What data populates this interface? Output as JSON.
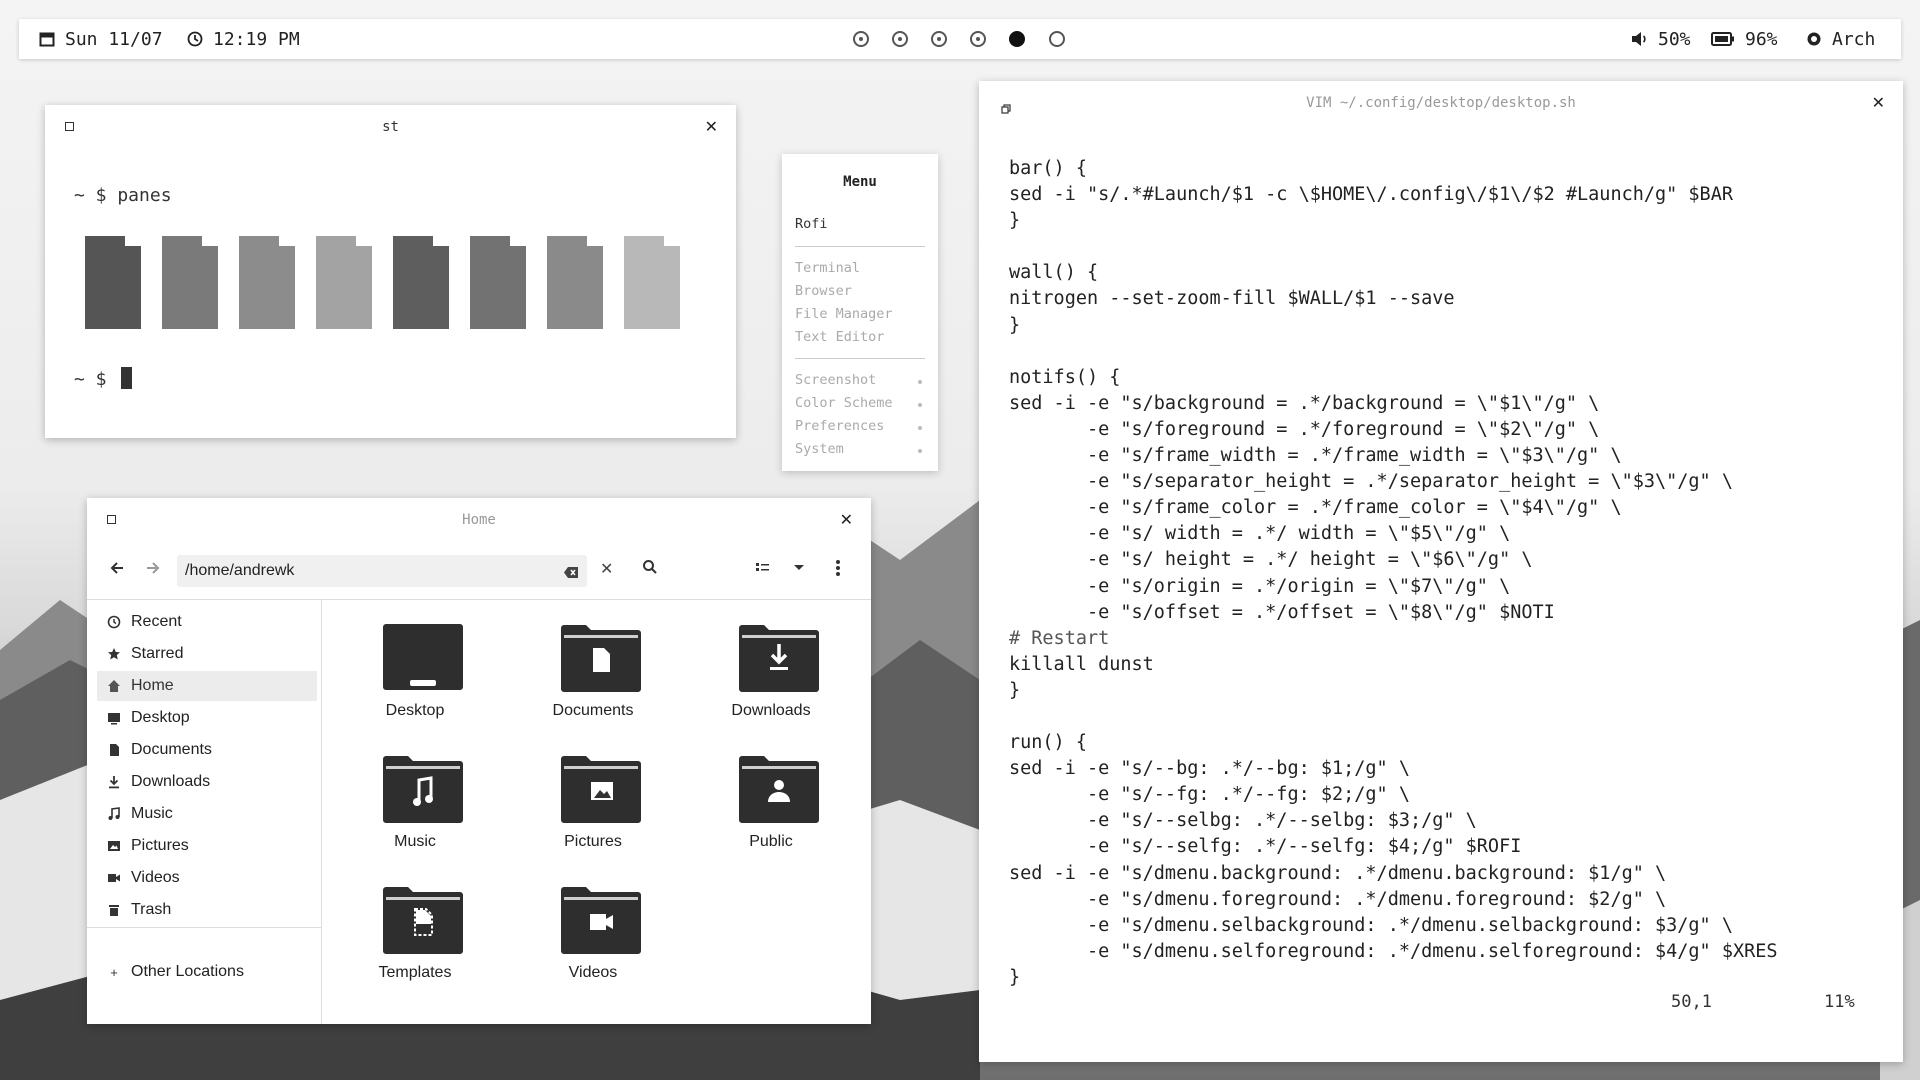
{
  "topbar": {
    "date": "Sun 11/07",
    "time": "12:19 PM",
    "volume": "50%",
    "battery": "96%",
    "os": "Arch",
    "workspaces": [
      "dot",
      "dot",
      "dot",
      "dot",
      "active",
      "empty"
    ]
  },
  "terminal": {
    "title": "st",
    "prompt1": "~ $ panes",
    "prompt2": "~ $",
    "pane_shades": [
      "#555555",
      "#7a7a7a",
      "#8c8c8c",
      "#a3a3a3",
      "#5e5e5e",
      "#727272",
      "#8a8a8a",
      "#b8b8b8"
    ]
  },
  "rofi": {
    "title": "Menu",
    "selected": "Rofi",
    "apps": [
      "Terminal",
      "Browser",
      "File Manager",
      "Text Editor"
    ],
    "system": [
      "Screenshot",
      "Color Scheme",
      "Preferences",
      "System"
    ]
  },
  "files": {
    "title": "Home",
    "path": "/home/andrewk",
    "sidebar": [
      {
        "label": "Recent",
        "icon": "clock-icon"
      },
      {
        "label": "Starred",
        "icon": "star-icon"
      },
      {
        "label": "Home",
        "icon": "home-icon"
      },
      {
        "label": "Desktop",
        "icon": "desktop-icon"
      },
      {
        "label": "Documents",
        "icon": "document-icon"
      },
      {
        "label": "Downloads",
        "icon": "download-icon"
      },
      {
        "label": "Music",
        "icon": "music-icon"
      },
      {
        "label": "Pictures",
        "icon": "picture-icon"
      },
      {
        "label": "Videos",
        "icon": "video-icon"
      },
      {
        "label": "Trash",
        "icon": "trash-icon"
      }
    ],
    "other_locations": "Other Locations",
    "folders": [
      "Desktop",
      "Documents",
      "Downloads",
      "Music",
      "Pictures",
      "Public",
      "Templates",
      "Videos"
    ]
  },
  "vim": {
    "title": "VIM ~/.config/desktop/desktop.sh",
    "lines": [
      "bar() {",
      "sed -i \"s/.*#Launch/$1 -c \\$HOME\\/.config\\/$1\\/$2 #Launch/g\" $BAR",
      "}",
      "",
      "wall() {",
      "nitrogen --set-zoom-fill $WALL/$1 --save",
      "}",
      "",
      "notifs() {",
      "sed -i -e \"s/background = .*/background = \\\"$1\\\"/g\" \\",
      "       -e \"s/foreground = .*/foreground = \\\"$2\\\"/g\" \\",
      "       -e \"s/frame_width = .*/frame_width = \\\"$3\\\"/g\" \\",
      "       -e \"s/separator_height = .*/separator_height = \\\"$3\\\"/g\" \\",
      "       -e \"s/frame_color = .*/frame_color = \\\"$4\\\"/g\" \\",
      "       -e \"s/ width = .*/ width = \\\"$5\\\"/g\" \\",
      "       -e \"s/ height = .*/ height = \\\"$6\\\"/g\" \\",
      "       -e \"s/origin = .*/origin = \\\"$7\\\"/g\" \\",
      "       -e \"s/offset = .*/offset = \\\"$8\\\"/g\" $NOTI",
      "# Restart",
      "killall dunst",
      "}",
      "",
      "run() {",
      "sed -i -e \"s/--bg: .*/--bg: $1;/g\" \\",
      "       -e \"s/--fg: .*/--fg: $2;/g\" \\",
      "       -e \"s/--selbg: .*/--selbg: $3;/g\" \\",
      "       -e \"s/--selfg: .*/--selfg: $4;/g\" $ROFI",
      "sed -i -e \"s/dmenu.background: .*/dmenu.background: $1/g\" \\",
      "       -e \"s/dmenu.foreground: .*/dmenu.foreground: $2/g\" \\",
      "       -e \"s/dmenu.selbackground: .*/dmenu.selbackground: $3/g\" \\",
      "       -e \"s/dmenu.selforeground: .*/dmenu.selforeground: $4/g\" $XRES",
      "}"
    ],
    "position": "50,1",
    "percent": "11%"
  }
}
